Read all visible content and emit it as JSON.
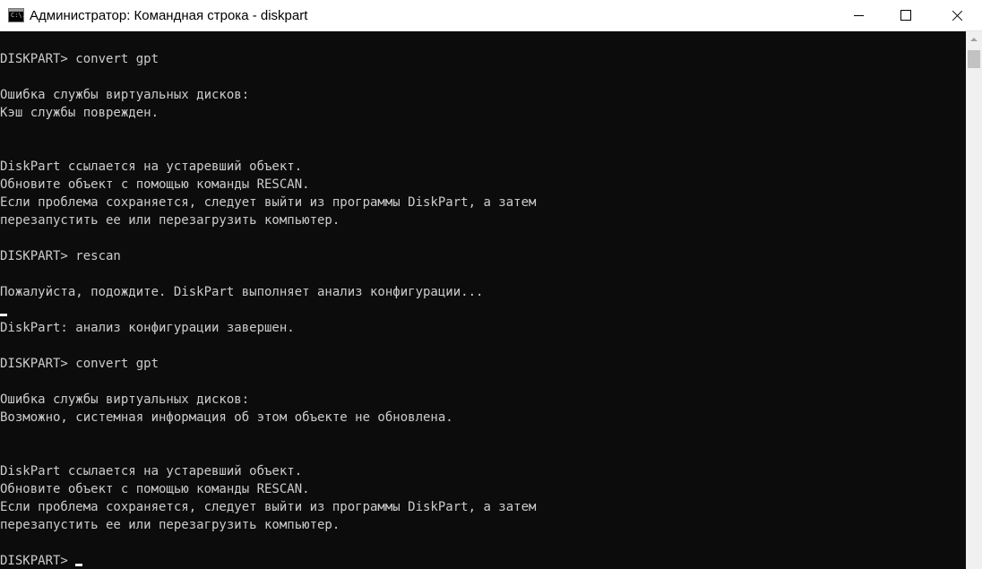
{
  "window": {
    "title": "Администратор: Командная строка - diskpart",
    "icon_text": "C:\\.",
    "icon_name": "cmd-app-icon",
    "controls": [
      "minimize-icon",
      "maximize-icon",
      "close-icon"
    ]
  },
  "console": {
    "lines": [
      "DISKPART> convert gpt",
      "",
      "Ошибка службы виртуальных дисков:",
      "Кэш службы поврежден.",
      "",
      "",
      "DiskPart ссылается на устаревший объект.",
      "Обновите объект с помощью команды RESCAN.",
      "Если проблема сохраняется, следует выйти из программы DiskPart, а затем",
      "перезапустить ее или перезагрузить компьютер.",
      "",
      "DISKPART> rescan",
      "",
      "Пожалуйста, подождите. DiskPart выполняет анализ конфигурации...",
      "",
      "DiskPart: анализ конфигурации завершен.",
      "",
      "DISKPART> convert gpt",
      "",
      "Ошибка службы виртуальных дисков:",
      "Возможно, системная информация об этом объекте не обновлена.",
      "",
      "",
      "DiskPart ссылается на устаревший объект.",
      "Обновите объект с помощью команды RESCAN.",
      "Если проблема сохраняется, следует выйти из программы DiskPart, а затем",
      "перезапустить ее или перезагрузить компьютер.",
      "",
      "DISKPART> "
    ]
  },
  "colors": {
    "console_background": "#0c0c0c",
    "console_text": "#cccccc",
    "titlebar_background": "#ffffff"
  }
}
